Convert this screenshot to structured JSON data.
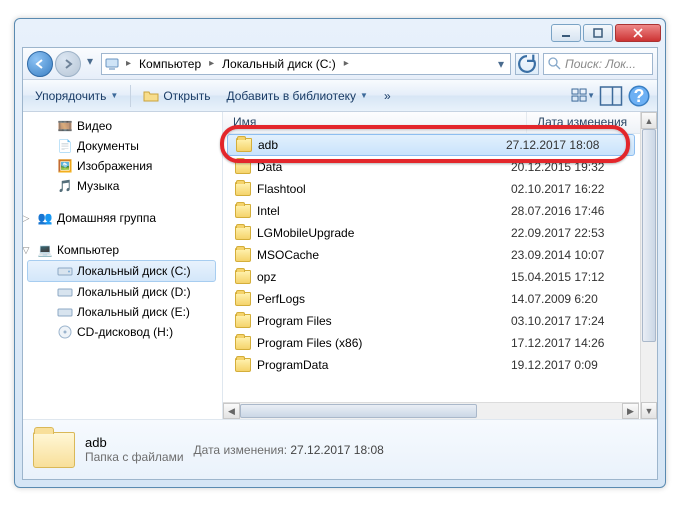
{
  "breadcrumb": {
    "seg1": "Компьютер",
    "seg2": "Локальный диск (C:)"
  },
  "search": {
    "placeholder": "Поиск: Лок..."
  },
  "toolbar": {
    "organize": "Упорядочить",
    "open": "Открыть",
    "library": "Добавить в библиотеку",
    "more": "»"
  },
  "tree": {
    "video": "Видео",
    "documents": "Документы",
    "images": "Изображения",
    "music": "Музыка",
    "homegroup": "Домашняя группа",
    "computer": "Компьютер",
    "disk_c": "Локальный диск (C:)",
    "disk_d": "Локальный диск (D:)",
    "disk_e": "Локальный диск (E:)",
    "cd_h": "CD-дисковод (H:)"
  },
  "columns": {
    "name": "Имя",
    "date": "Дата изменения"
  },
  "items": [
    {
      "name": "adb",
      "date": "27.12.2017 18:08",
      "selected": true
    },
    {
      "name": "Data",
      "date": "20.12.2015 19:32"
    },
    {
      "name": "Flashtool",
      "date": "02.10.2017 16:22"
    },
    {
      "name": "Intel",
      "date": "28.07.2016 17:46"
    },
    {
      "name": "LGMobileUpgrade",
      "date": "22.09.2017 22:53"
    },
    {
      "name": "MSOCache",
      "date": "23.09.2014 10:07"
    },
    {
      "name": "opz",
      "date": "15.04.2015 17:12"
    },
    {
      "name": "PerfLogs",
      "date": "14.07.2009 6:20"
    },
    {
      "name": "Program Files",
      "date": "03.10.2017 17:24"
    },
    {
      "name": "Program Files (x86)",
      "date": "17.12.2017 14:26"
    },
    {
      "name": "ProgramData",
      "date": "19.12.2017 0:09"
    }
  ],
  "details": {
    "name": "adb",
    "type": "Папка с файлами",
    "date_label": "Дата изменения:",
    "date_value": "27.12.2017 18:08"
  }
}
